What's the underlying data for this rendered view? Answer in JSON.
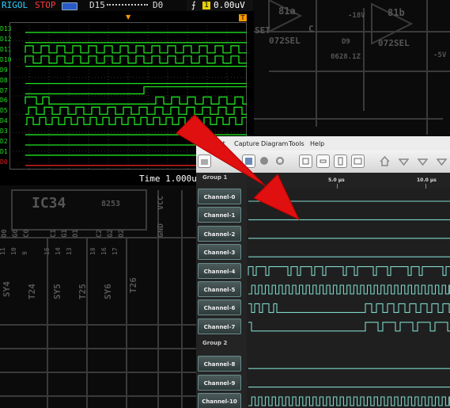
{
  "background": {
    "schematic_labels": [
      "81a",
      "81b",
      "-18V",
      "D9",
      "072SEL",
      "072SEL",
      "0628.1Z",
      "-5V",
      "SET",
      "C",
      "IC34",
      "8253",
      "GND",
      "VCC",
      "C1",
      "G1",
      "O1",
      "C2",
      "G2",
      "O2",
      "15",
      "14",
      "13",
      "18",
      "16",
      "17",
      "11",
      "10",
      "9",
      "SY4",
      "T24",
      "SY5",
      "T25",
      "SY6",
      "T26",
      "C0",
      "G0",
      "O0"
    ]
  },
  "scope": {
    "brand": "RIGOL",
    "state": "STOP",
    "channel_range_start": "D15",
    "channel_range_end": "D0",
    "trigger_source": "1",
    "trigger_level": "0.00uV",
    "trigger_mode_icon": "rising-edge-icon",
    "t_marker": "T",
    "timebase": "Time 1.000us",
    "channels": [
      "D13",
      "D12",
      "D11",
      "D10",
      "D9",
      "D8",
      "D7",
      "D6",
      "D5",
      "D4",
      "D3",
      "D2",
      "D1",
      "D0"
    ],
    "colors": {
      "trace": "#20e020",
      "d0": "#e02020",
      "labels": "#20e020",
      "brand": "#2ad0ff",
      "stop": "#ff3b3b"
    }
  },
  "logic_analyzer": {
    "menu": [
      "...t",
      "Capture",
      "Diagram",
      "Tools",
      "Help"
    ],
    "toolbar_icons": [
      "open-icon",
      "save-icon",
      "stop-icon",
      "record-icon",
      "refresh-icon",
      "zoom-in-icon",
      "zoom-out-icon",
      "zoom-fit-icon",
      "zoom-original-icon",
      "home-icon",
      "marker-icon",
      "marker-icon",
      "marker-icon"
    ],
    "time_ticks": [
      "5.0 µs",
      "10.0 µs"
    ],
    "groups": [
      {
        "label": "Group 1",
        "channels": [
          "Channel-0",
          "Channel-1",
          "Channel-2",
          "Channel-3",
          "Channel-4",
          "Channel-5",
          "Channel-6",
          "Channel-7"
        ]
      },
      {
        "label": "Group 2",
        "channels": [
          "Channel-8",
          "Channel-9",
          "Channel-10"
        ]
      }
    ],
    "trace_color": "#7fd6c8"
  },
  "arrow": {
    "color": "#e01010"
  }
}
